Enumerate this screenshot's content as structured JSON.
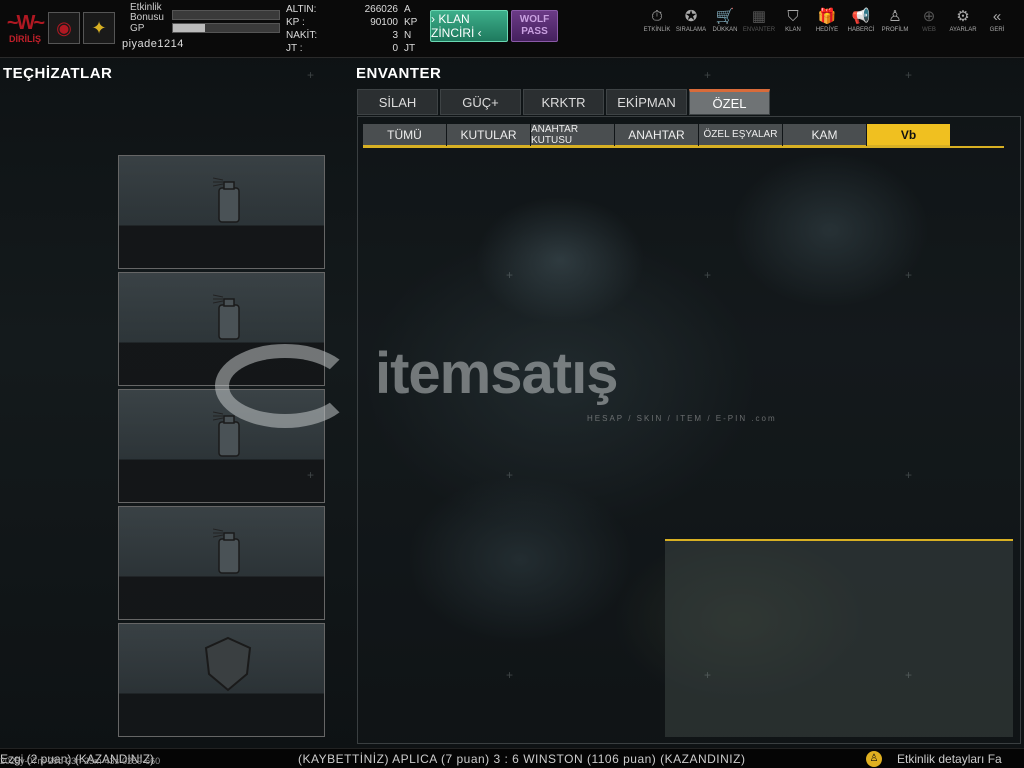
{
  "top": {
    "logo_text": "DİRİLİŞ",
    "etkinlik_label": "Etkinlik Bonusu",
    "gp_label": "GP",
    "etkinlik_fill": 0.0,
    "gp_fill": 0.3,
    "username": "piyade1214",
    "currency": [
      {
        "k": "ALTIN:",
        "v": "266026",
        "u": "A"
      },
      {
        "k": "KP :",
        "v": "90100",
        "u": "KP"
      },
      {
        "k": "NAKİT:",
        "v": "3",
        "u": "N"
      },
      {
        "k": "JT :",
        "v": "0",
        "u": "JT"
      }
    ],
    "klan_button": "› KLAN ZİNCİRİ ‹",
    "wolf_pass": "WOLF PASS",
    "nav": [
      {
        "label": "ETKİNLİK",
        "icon": "stopwatch-icon",
        "glyph": "⏱"
      },
      {
        "label": "SIRALAMA",
        "icon": "medal-icon",
        "glyph": "✪"
      },
      {
        "label": "DÜKKAN",
        "icon": "cart-icon",
        "glyph": "🛒"
      },
      {
        "label": "ENVANTER",
        "icon": "inventory-icon",
        "glyph": "▦"
      },
      {
        "label": "KLAN",
        "icon": "shield-icon",
        "glyph": "⛉"
      },
      {
        "label": "HEDİYE",
        "icon": "gift-icon",
        "glyph": "🎁"
      },
      {
        "label": "HABERCİ",
        "icon": "megaphone-icon",
        "glyph": "📢"
      },
      {
        "label": "PROFİLM",
        "icon": "profile-icon",
        "glyph": "♙"
      },
      {
        "label": "WEB",
        "icon": "globe-icon",
        "glyph": "⊕"
      },
      {
        "label": "AYARLAR",
        "icon": "gear-icon",
        "glyph": "⚙"
      },
      {
        "label": "GERİ",
        "icon": "back-icon",
        "glyph": "«"
      }
    ]
  },
  "equipment": {
    "title": "TEÇHİZATLAR",
    "slots": [
      "spray-can-icon",
      "spray-can-icon",
      "spray-can-icon",
      "spray-can-icon",
      "shield-icon"
    ]
  },
  "inventory": {
    "title": "ENVANTER",
    "tabs": [
      "SİLAH",
      "GÜÇ+",
      "KRKTR",
      "EKİPMAN",
      "ÖZEL"
    ],
    "active_tab": 4,
    "subtabs": [
      "TÜMÜ",
      "KUTULAR",
      "ANAHTAR KUTUSU",
      "ANAHTAR",
      "ÖZEL EŞYALAR",
      "KAM",
      "Vb"
    ],
    "active_subtab": 6
  },
  "watermark": {
    "brand": "itemsatış",
    "tagline": "HESAP / SKIN / ITEM / E-PIN .com"
  },
  "ticker": {
    "left": "Ezgi (2 puan) (KAZANDINIZ)",
    "timestamp": "2025y-07m-29d-23h-23m-43s-0259-660",
    "middle": "(KAYBETTİNİZ) APLICA (7 puan) 3 : 6 WINSTON (1106 puan) (KAZANDINIZ)",
    "right": "Etkinlik detayları Fa"
  },
  "colors": {
    "accent_yellow": "#f0c020",
    "active_tab_border": "#d96b3a",
    "klan_green": "#2f9a76",
    "wolf_purple": "#5a2d72"
  }
}
